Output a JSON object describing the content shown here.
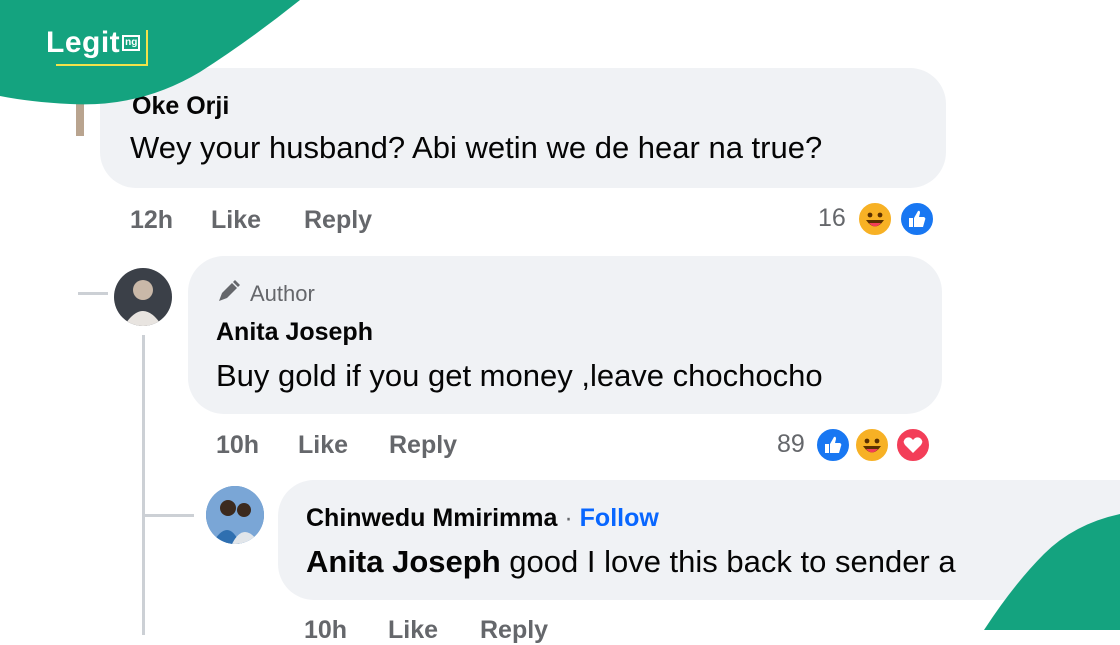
{
  "brand": {
    "logo_text": "Legit",
    "logo_suffix": "ng",
    "primary_color": "#14a37f"
  },
  "comments": [
    {
      "author": "Oke Orji",
      "text": "Wey your husband? Abi wetin we de hear na true?",
      "time": "12h",
      "like_label": "Like",
      "reply_label": "Reply",
      "reaction_count": "16",
      "reactions": [
        "haha-icon",
        "like-icon"
      ]
    },
    {
      "badge": "Author",
      "author": "Anita Joseph",
      "text": "Buy gold if you get money ,leave chochocho",
      "time": "10h",
      "like_label": "Like",
      "reply_label": "Reply",
      "reaction_count": "89",
      "reactions": [
        "like-icon",
        "haha-icon",
        "love-icon"
      ]
    },
    {
      "author": "Chinwedu Mmirimma",
      "separator": "·",
      "follow_label": "Follow",
      "mention": "Anita Joseph",
      "text": " good I love this back to sender a",
      "time": "10h",
      "like_label": "Like",
      "reply_label": "Reply"
    }
  ],
  "colors": {
    "bubble": "#f0f2f5",
    "meta_text": "#65676b",
    "link_blue": "#0866ff",
    "like_blue": "#1877f2",
    "love_red": "#f33e58",
    "haha_yellow": "#f7b125"
  }
}
